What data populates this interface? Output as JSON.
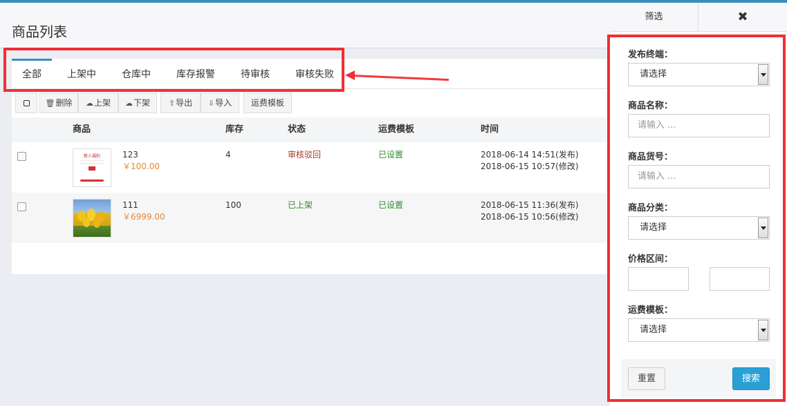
{
  "page": {
    "title": "商品列表"
  },
  "tabs": [
    {
      "label": "全部",
      "active": true
    },
    {
      "label": "上架中"
    },
    {
      "label": "仓库中"
    },
    {
      "label": "库存报警"
    },
    {
      "label": "待审核"
    },
    {
      "label": "审核失败"
    }
  ],
  "toolbar": {
    "delete_label": "删除",
    "onshelf_label": "上架",
    "offshelf_label": "下架",
    "export_label": "导出",
    "import_label": "导入",
    "shipping_label": "运费模板"
  },
  "table": {
    "headers": {
      "product": "商品",
      "stock": "库存",
      "status": "状态",
      "shipping": "运费模板",
      "time": "时间"
    },
    "rows": [
      {
        "name": "123",
        "price": "￥100.00",
        "stock": "4",
        "status": "审核驳回",
        "status_color": "#b03a2e",
        "shipping": "已设置",
        "time1": "2018-06-14 14:51(发布)",
        "time2": "2018-06-15 10:57(修改)",
        "thumb_text": "新人福利"
      },
      {
        "name": "111",
        "price": "￥6999.00",
        "stock": "100",
        "status": "已上架",
        "status_color": "#2f8b2f",
        "shipping": "已设置",
        "time1": "2018-06-15 11:36(发布)",
        "time2": "2018-06-15 10:56(修改)"
      }
    ]
  },
  "filter": {
    "tab_label": "筛选",
    "close_icon": "close-icon",
    "terminal_label": "发布终端：",
    "terminal_value": "请选择",
    "name_label": "商品名称：",
    "name_placeholder": "请输入 ...",
    "sku_label": "商品货号：",
    "sku_placeholder": "请输入 ...",
    "category_label": "商品分类：",
    "category_value": "请选择",
    "price_label": "价格区间：",
    "shipping_label": "运费模板：",
    "shipping_value": "请选择",
    "reset_label": "重置",
    "search_label": "搜索"
  },
  "colors": {
    "accent": "#3c8dbc",
    "annotation": "#ef2f35",
    "search_button": "#2aa0d4",
    "price": "#e8892e"
  }
}
